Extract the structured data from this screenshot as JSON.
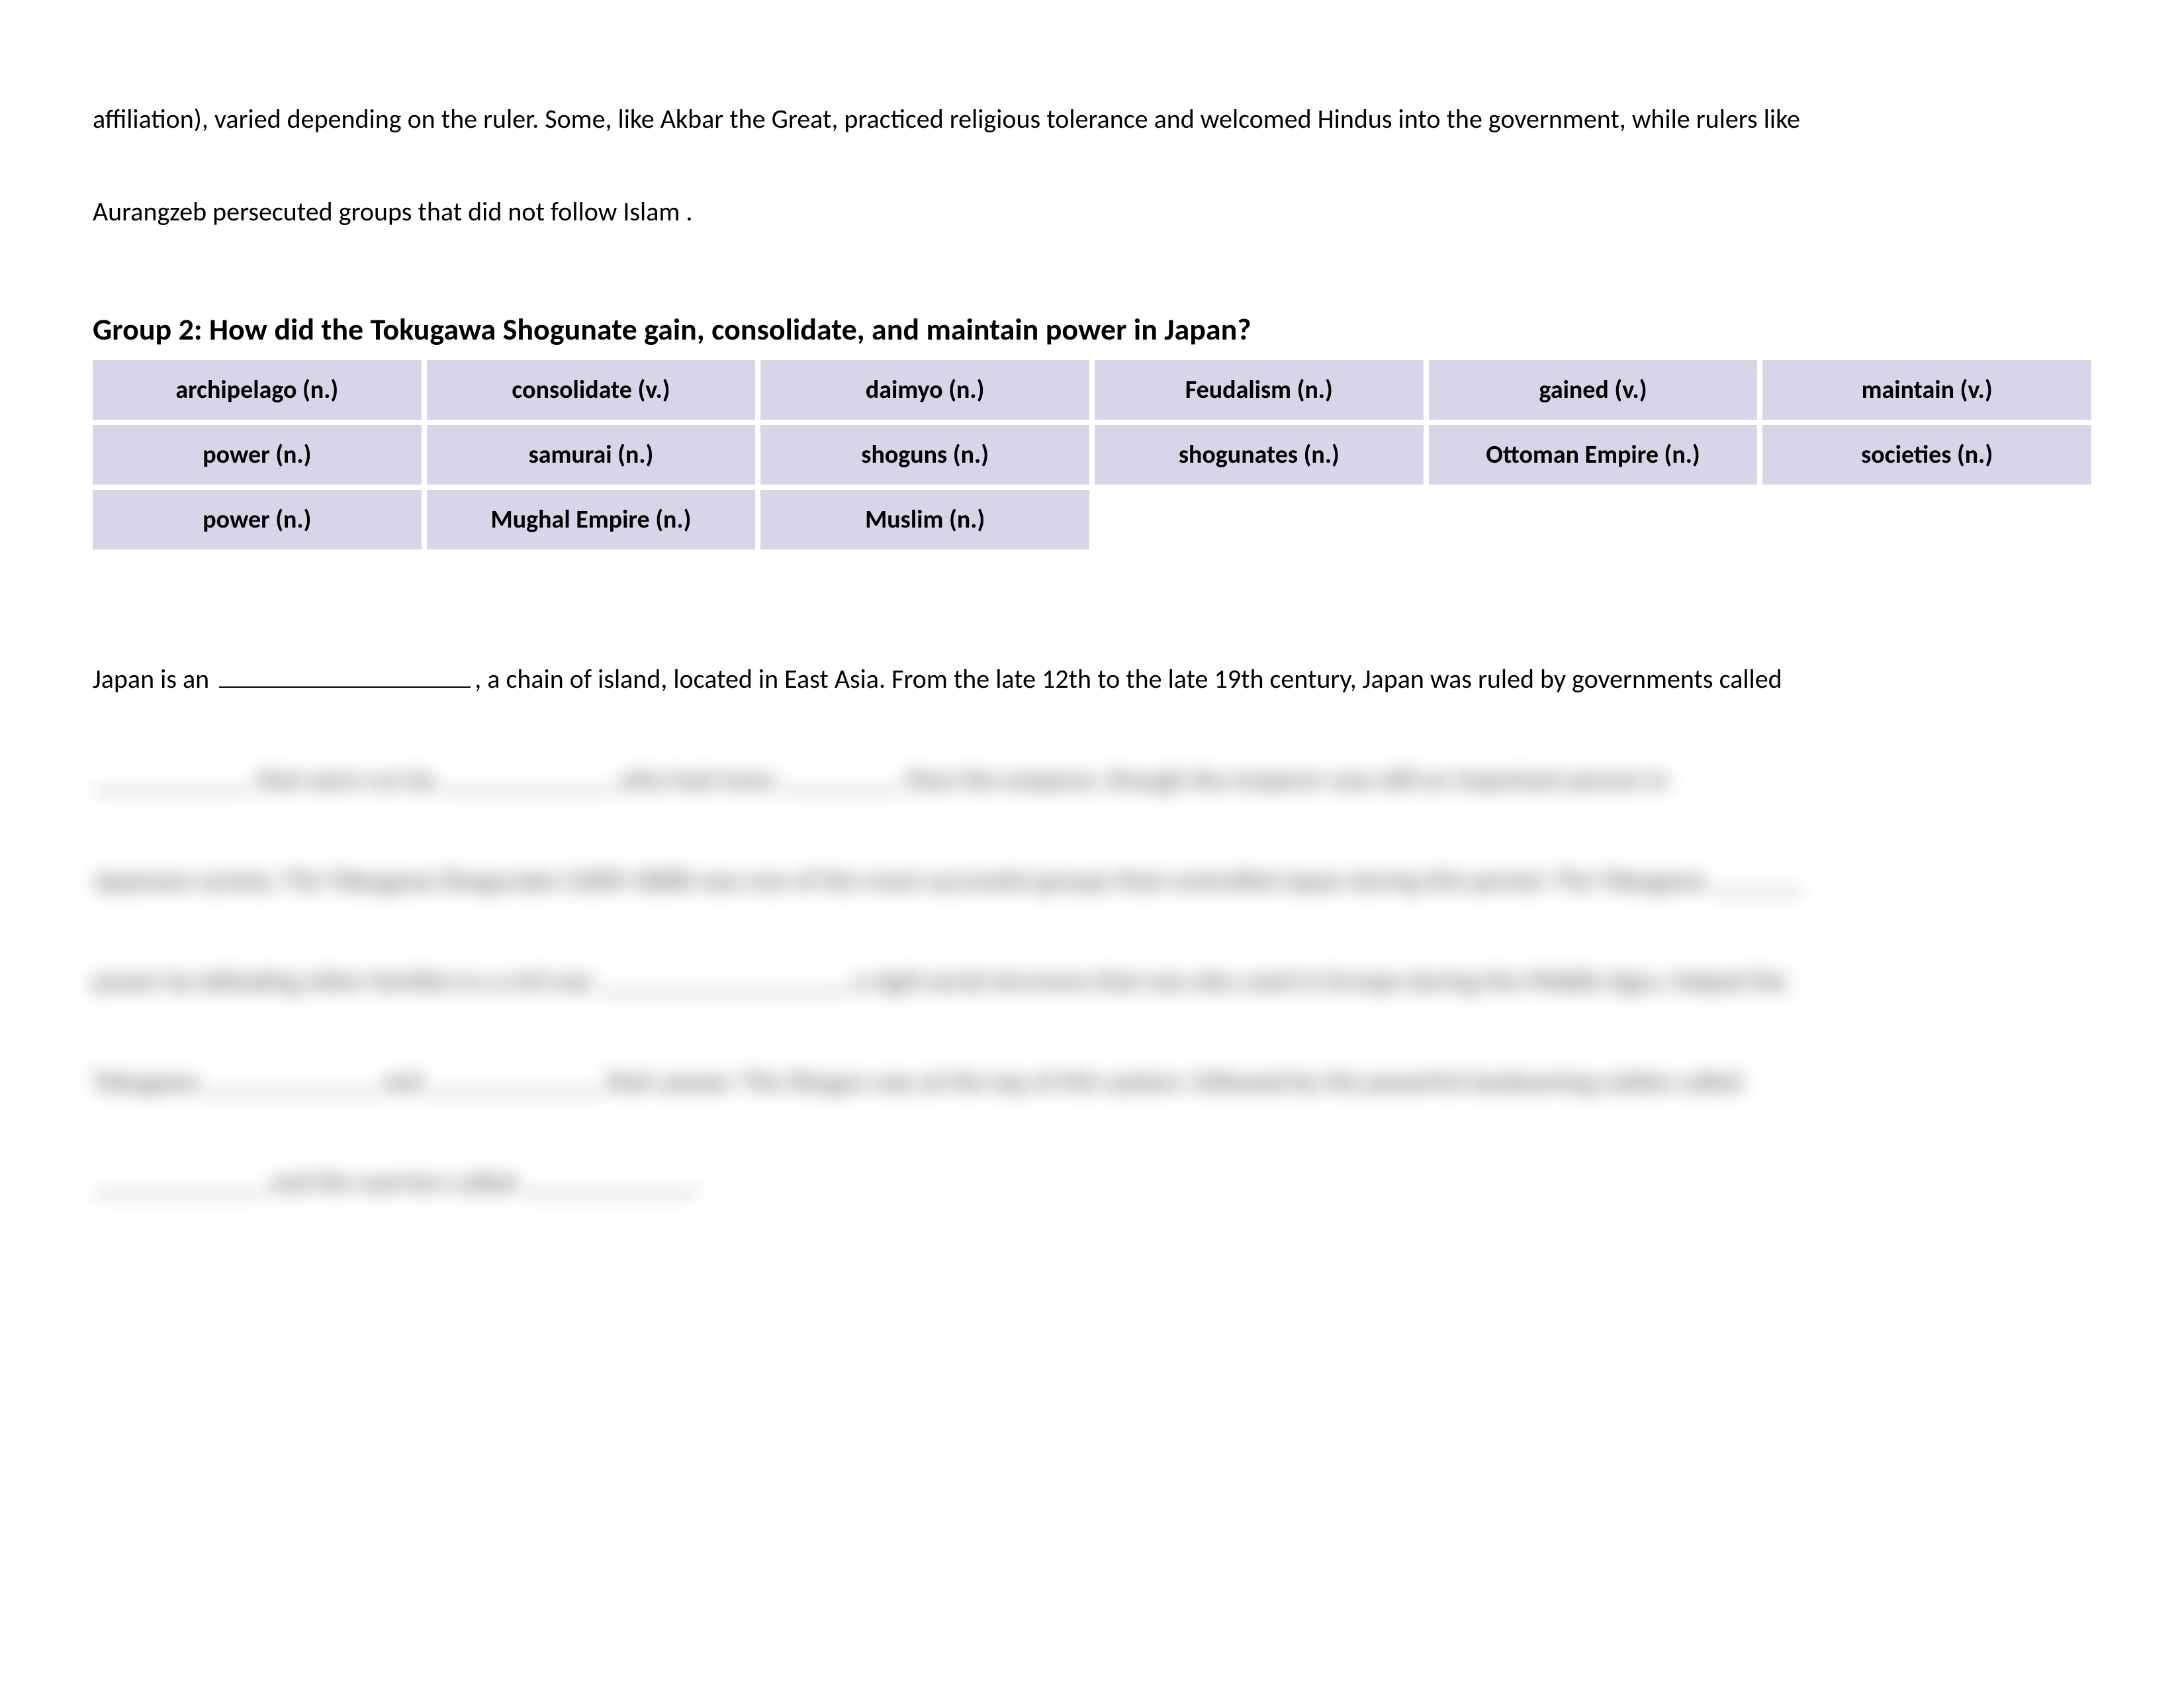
{
  "intro": {
    "line1": "affiliation), varied depending on the ruler. Some, like Akbar the Great, practiced religious tolerance and welcomed Hindus into the government, while rulers like",
    "line2": "Aurangzeb persecuted groups that did not follow Islam ."
  },
  "group_heading": "Group 2: How did the Tokugawa Shogunate gain, consolidate, and maintain power in Japan?",
  "vocab": [
    "archipelago (n.)",
    "consolidate (v.)",
    "daimyo (n.)",
    "Feudalism (n.)",
    "gained (v.)",
    "maintain (v.)",
    "power (n.)",
    "samurai (n.)",
    "shoguns (n.)",
    "shogunates (n.)",
    "Ottoman Empire (n.)",
    "societies (n.)",
    "power (n.)",
    "Mughal Empire (n.)",
    "Muslim (n.)"
  ],
  "fill": {
    "part1": "Japan is an ",
    "part2": ", a chain of island,  located in East Asia. From the late 12th to the late 19th century, Japan was ruled by governments called"
  },
  "blurred_lines": [
    "____________ that were run by _____________ who had more _________ than the emperor, though the emperor was still an important person in",
    "Japanese society. The Tokugawa Shogunate (1600-1868) was one of the most successful groups that controlled Japan during this period. The Tokugawa _______",
    "power by defeating other families in a civil war. __________________, a rigid social structure that was also used in Europe during the Middle Ages, helped the",
    "Tokugawa _____________ and _____________ their power. The Shogun was at the top of this system, followed by the powerful landowning nobles called",
    "_____________ and the warriors called _____________."
  ]
}
